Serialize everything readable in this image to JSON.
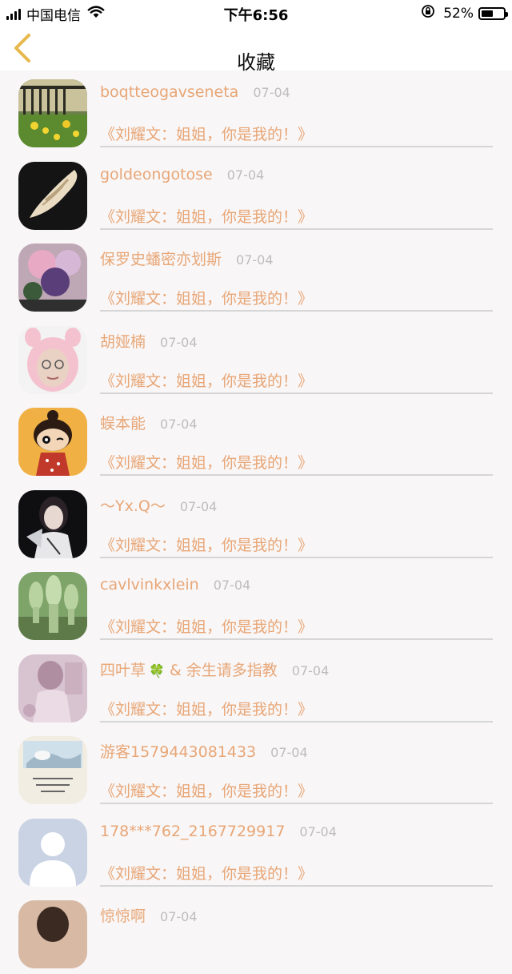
{
  "status_bar": {
    "carrier": "中国电信",
    "time": "下午6:56",
    "battery_percent": "52%",
    "battery_level": 0.52
  },
  "nav": {
    "title": "收藏"
  },
  "items": [
    {
      "name": "boqtteogavseneta",
      "date": "07-04",
      "title": "《刘耀文：姐姐，你是我的！》"
    },
    {
      "name": "goldeongotose",
      "date": "07-04",
      "title": "《刘耀文：姐姐，你是我的！》"
    },
    {
      "name": "保罗史蟠密亦划斯",
      "date": "07-04",
      "title": "《刘耀文：姐姐，你是我的！》"
    },
    {
      "name": "胡娅楠",
      "date": "07-04",
      "title": "《刘耀文：姐姐，你是我的！》"
    },
    {
      "name": "蜈本能",
      "date": "07-04",
      "title": "《刘耀文：姐姐，你是我的！》"
    },
    {
      "name": "～Yx.Q～",
      "date": "07-04",
      "title": "《刘耀文：姐姐，你是我的！》"
    },
    {
      "name": "cavlvinkxlein",
      "date": "07-04",
      "title": "《刘耀文：姐姐，你是我的！》"
    },
    {
      "name_prefix": "四叶草",
      "name_emoji": "🍀",
      "name_suffix": "& 余生请多指教",
      "date": "07-04",
      "title": "《刘耀文：姐姐，你是我的！》"
    },
    {
      "name": "游客1579443081433",
      "date": "07-04",
      "title": "《刘耀文：姐姐，你是我的！》"
    },
    {
      "name": "178***762_2167729917",
      "date": "07-04",
      "title": "《刘耀文：姐姐，你是我的！》"
    },
    {
      "name": "惊惊啊",
      "date": "07-04",
      "title": ""
    }
  ],
  "colors": {
    "accent": "#e8a676",
    "date": "#bdbdbd",
    "divider": "#d6d6d6",
    "background": "#f8f6f7",
    "back_arrow": "#e8b84a"
  },
  "icons": {
    "back": "chevron-left-icon",
    "wifi": "wifi-icon",
    "lock": "rotation-lock-icon",
    "battery": "battery-icon"
  }
}
